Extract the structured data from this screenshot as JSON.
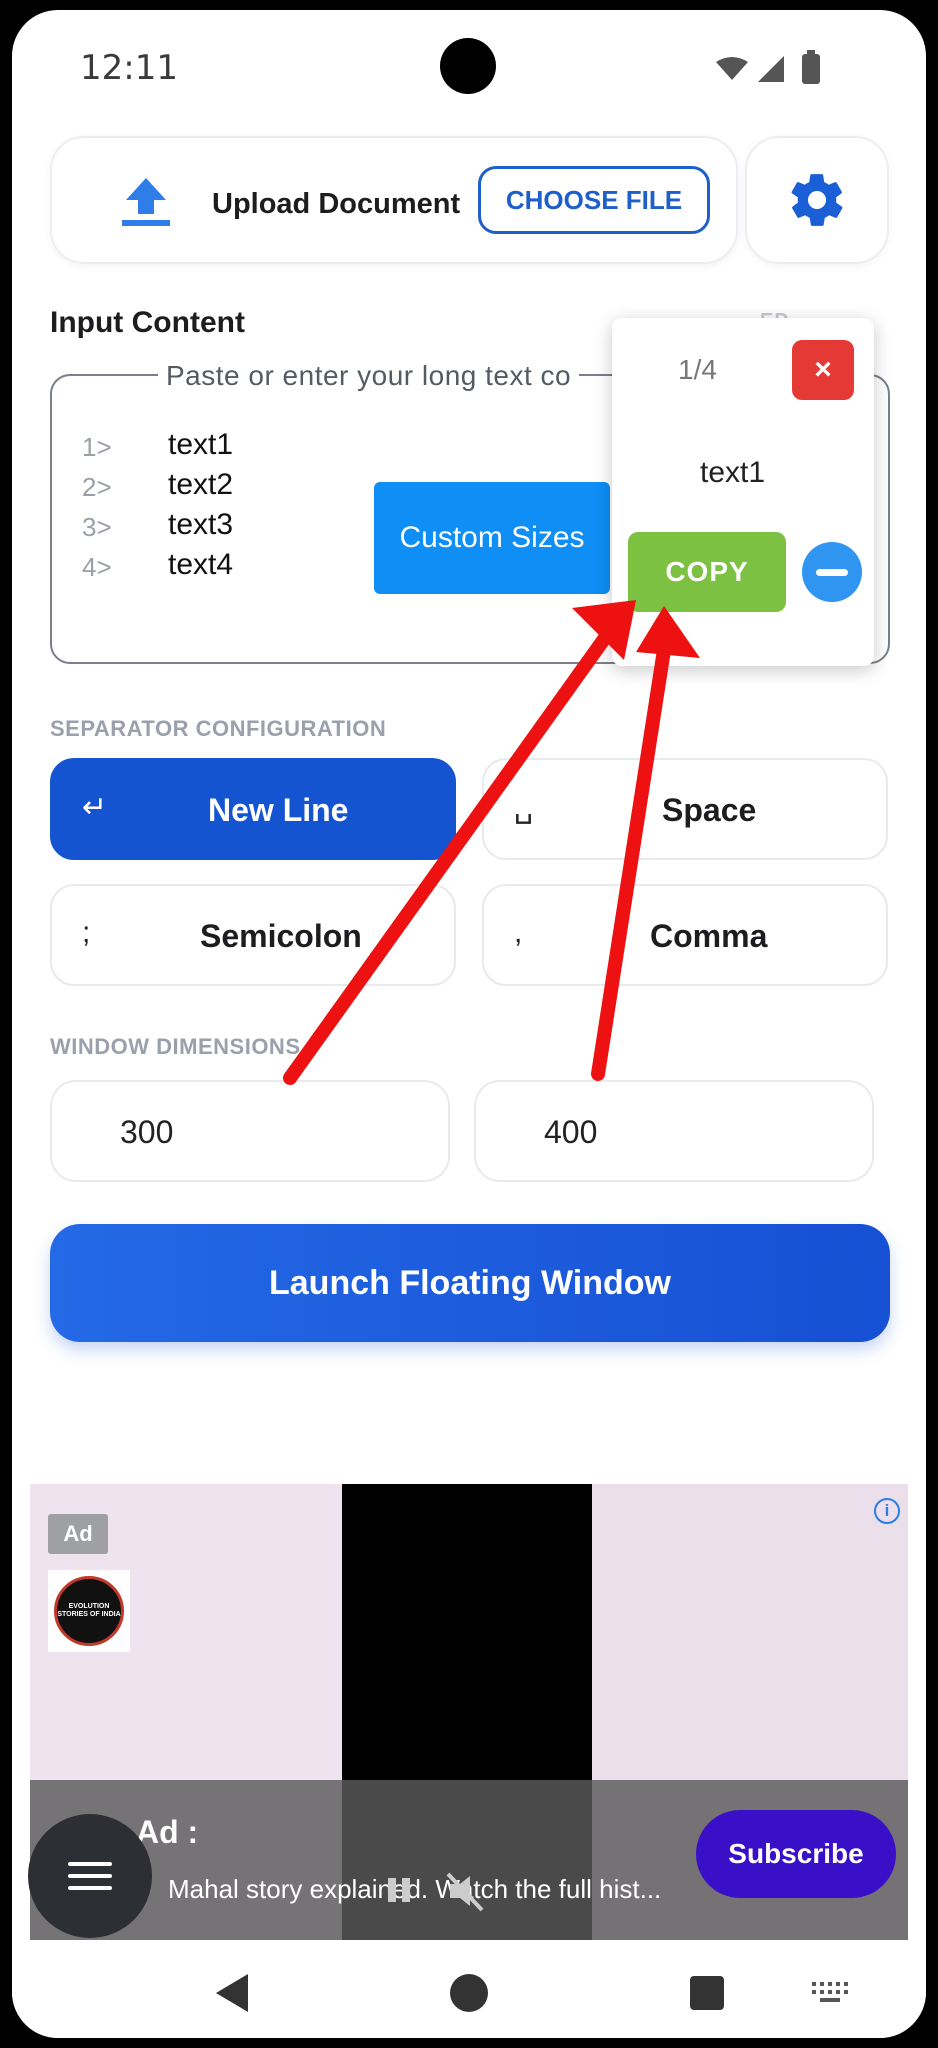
{
  "status_bar": {
    "time": "12:11"
  },
  "upload": {
    "label": "Upload Document",
    "choose_label": "CHOOSE FILE"
  },
  "input": {
    "title": "Input Content",
    "faint_label": "ED",
    "placeholder": "Paste or enter your long text co",
    "lines": [
      {
        "num": "1>",
        "text": "text1"
      },
      {
        "num": "2>",
        "text": "text2"
      },
      {
        "num": "3>",
        "text": "text3"
      },
      {
        "num": "4>",
        "text": "text4"
      }
    ]
  },
  "custom_sizes": {
    "label": "Custom Sizes"
  },
  "floating_window": {
    "counter": "1/4",
    "close": "×",
    "current_text": "text1",
    "copy_label": "COPY"
  },
  "separator": {
    "title": "SEPARATOR CONFIGURATION",
    "options": [
      {
        "label": "New Line",
        "icon": "↵",
        "selected": true
      },
      {
        "label": "Space",
        "icon": "␣",
        "selected": false
      },
      {
        "label": "Semicolon",
        "icon": ";",
        "selected": false
      },
      {
        "label": "Comma",
        "icon": ",",
        "selected": false
      }
    ]
  },
  "dimensions": {
    "title": "WINDOW DIMENSIONS",
    "width": "300",
    "height": "400"
  },
  "launch": {
    "label": "Launch Floating Window"
  },
  "ad": {
    "badge": "Ad",
    "logo_text": "EVOLUTION STORIES OF INDIA",
    "title": "Ad :",
    "description": "Mahal story explained. Watch the full hist...",
    "subscribe_label": "Subscribe",
    "info": "i"
  },
  "colors": {
    "primary": "#1554d1",
    "accent_blue": "#0f8ef5",
    "copy_green": "#7cc142",
    "close_red": "#e53935",
    "annotation_red": "#ee1111"
  }
}
